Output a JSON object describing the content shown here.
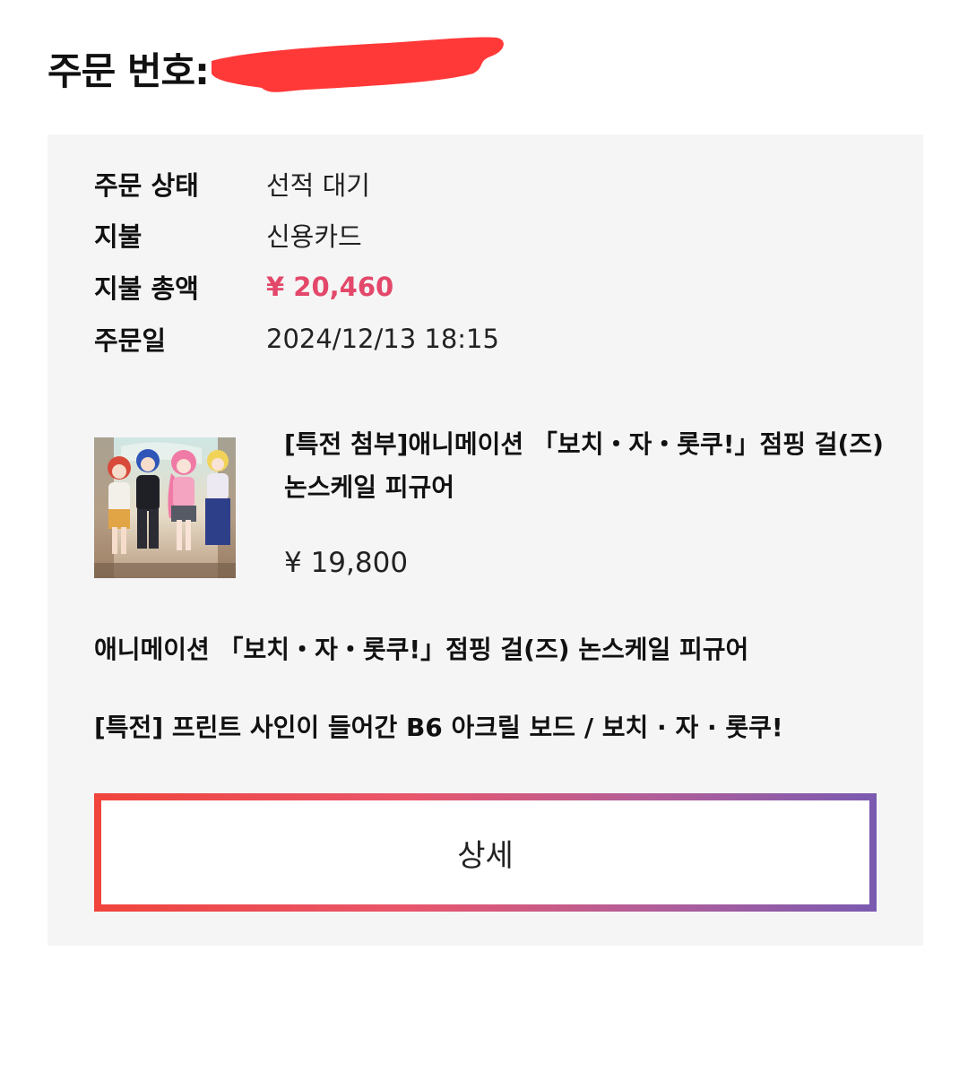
{
  "header": {
    "order_number_label": "주문 번호:"
  },
  "order_info": [
    {
      "label": "주문 상태",
      "value": "선적 대기"
    },
    {
      "label": "지불",
      "value": "신용카드"
    },
    {
      "label": "지불 총액",
      "value": "¥ 20,460"
    },
    {
      "label": "주문일",
      "value": "2024/12/13 18:15"
    }
  ],
  "product": {
    "name": "[특전 첨부]애니메이션 「보치・자・롯쿠!」점핑 걸(즈) 논스케일 피규어",
    "price": "¥ 19,800"
  },
  "sub_items": [
    "애니메이션 「보치・자・롯쿠!」점핑 걸(즈) 논스케일 피규어",
    "[특전] 프린트 사인이 들어간 B6 아크릴 보드 / 보치 · 자 · 롯쿠!"
  ],
  "detail_button": {
    "label": "상세"
  },
  "colors": {
    "price_accent": "#e3486a",
    "card_background": "#f5f5f5",
    "button_gradient_start": "#f0443c",
    "button_gradient_end": "#7a5ab0",
    "redaction": "#ff3838"
  }
}
